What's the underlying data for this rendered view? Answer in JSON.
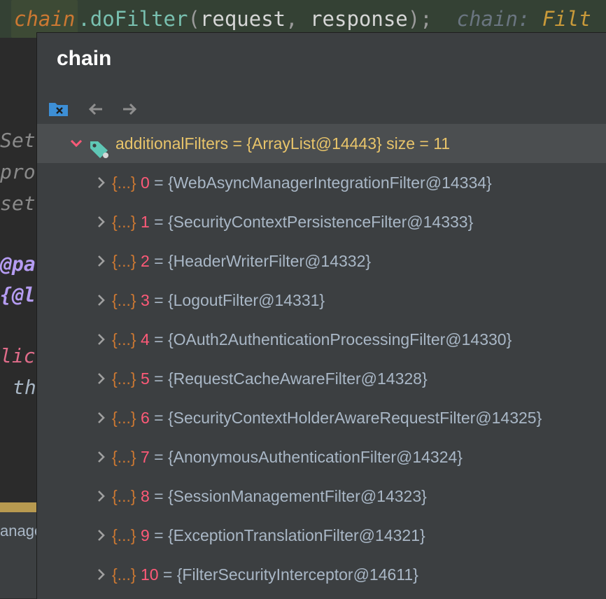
{
  "editor": {
    "top_line": {
      "var": "chain",
      "method": ".doFilter",
      "open": "(",
      "arg1": "request",
      "comma": ",",
      "arg2": "response",
      "close": ");",
      "hint_label": "chain:",
      "hint_type": "Filt"
    },
    "fragments": [
      "Set",
      "pro",
      "set",
      "@pa",
      "{@l",
      "lic",
      "th"
    ],
    "left_panel_text": "anage",
    "colors": {
      "italic_gray": "#8a8a8a",
      "annotation": "#b59cf2",
      "keyword": "#e06c8a",
      "field": "#a9b7c6"
    }
  },
  "popup": {
    "title": "chain",
    "toolbar": {
      "icons": [
        "folder-close-icon",
        "back-arrow-icon",
        "forward-arrow-icon"
      ]
    },
    "root": {
      "label": "additionalFilters = {ArrayList@14443}  size = 11",
      "expanded": true
    },
    "items": [
      {
        "brace": "{...}",
        "index": "0",
        "eq": "=",
        "value": "{WebAsyncManagerIntegrationFilter@14334}"
      },
      {
        "brace": "{...}",
        "index": "1",
        "eq": "=",
        "value": "{SecurityContextPersistenceFilter@14333}"
      },
      {
        "brace": "{...}",
        "index": "2",
        "eq": "=",
        "value": "{HeaderWriterFilter@14332}"
      },
      {
        "brace": "{...}",
        "index": "3",
        "eq": "=",
        "value": "{LogoutFilter@14331}"
      },
      {
        "brace": "{...}",
        "index": "4",
        "eq": "=",
        "value": "{OAuth2AuthenticationProcessingFilter@14330}"
      },
      {
        "brace": "{...}",
        "index": "5",
        "eq": "=",
        "value": "{RequestCacheAwareFilter@14328}"
      },
      {
        "brace": "{...}",
        "index": "6",
        "eq": "=",
        "value": "{SecurityContextHolderAwareRequestFilter@14325}"
      },
      {
        "brace": "{...}",
        "index": "7",
        "eq": "=",
        "value": "{AnonymousAuthenticationFilter@14324}"
      },
      {
        "brace": "{...}",
        "index": "8",
        "eq": "=",
        "value": "{SessionManagementFilter@14323}"
      },
      {
        "brace": "{...}",
        "index": "9",
        "eq": "=",
        "value": "{ExceptionTranslationFilter@14321}"
      },
      {
        "brace": "{...}",
        "index": "10",
        "eq": "=",
        "value": "{FilterSecurityInterceptor@14611}"
      }
    ]
  }
}
